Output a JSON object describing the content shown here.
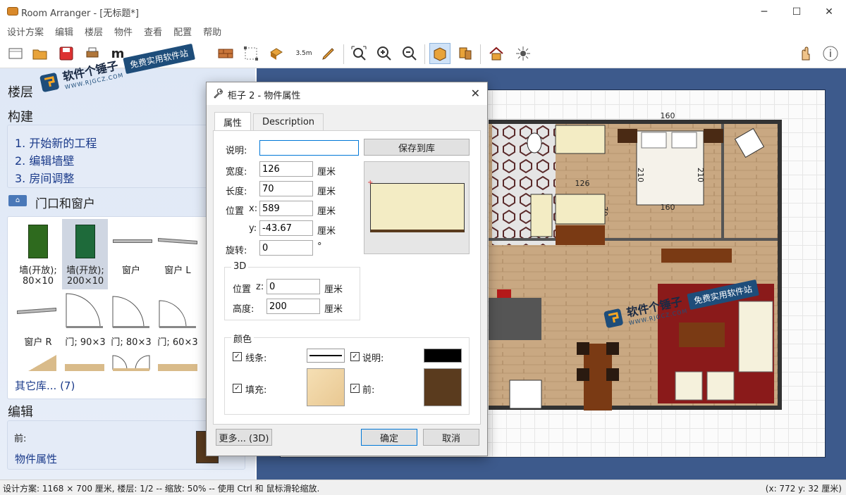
{
  "window": {
    "title": "Room Arranger - [无标题*]",
    "minimize": "─",
    "maximize": "☐",
    "close": "✕"
  },
  "menu": [
    "设计方案",
    "编辑",
    "楼层",
    "物件",
    "查看",
    "配置",
    "帮助"
  ],
  "toolbar": {
    "icons": [
      "new-icon",
      "open-icon",
      "save-icon",
      "print-icon",
      "wall-icon",
      "node-icon",
      "object-icon",
      "measure-icon",
      "pen-icon",
      "zoom-fit-icon",
      "zoom-in-icon",
      "zoom-out-icon",
      "view-2d-icon",
      "view-3d-icon",
      "house-icon",
      "effects-icon",
      "hand-icon",
      "help-icon"
    ],
    "measure_label": "3.5m",
    "partial_letter": "m"
  },
  "left_panel": {
    "floor_heading": "楼层",
    "build_heading": "构建",
    "build_steps": [
      "1. 开始新的工程",
      "2. 编辑墙壁",
      "3. 房间调整"
    ],
    "doors_heading": "门口和窗户",
    "items": [
      {
        "label": "墙(开放);\n80×10"
      },
      {
        "label": "墙(开放);\n200×10"
      },
      {
        "label": "窗户"
      },
      {
        "label": "窗户 L"
      },
      {
        "label": "窗户 R"
      },
      {
        "label": "门; 90×3"
      },
      {
        "label": "门; 80×3"
      },
      {
        "label": "门; 60×3"
      }
    ],
    "more_library": "其它库... (7)",
    "edit_heading": "编辑",
    "edit_front_label": "前:",
    "edit_properties": "物件属性"
  },
  "watermark": {
    "brand": "软件个锤子",
    "tag": "免费实用软件站",
    "url": "WWW.RJGCZ.COM"
  },
  "dialog": {
    "title": "柜子 2 - 物件属性",
    "tabs": [
      "属性",
      "Description"
    ],
    "description_label": "说明:",
    "description_value": "",
    "save_library": "保存到库",
    "width_label": "宽度:",
    "width_value": "126",
    "length_label": "长度:",
    "length_value": "70",
    "position_label": "位置",
    "x_label": "x:",
    "x_value": "589",
    "y_label": "y:",
    "y_value": "-43.67",
    "rotation_label": "旋转:",
    "rotation_value": "0",
    "degree": "°",
    "unit": "厘米",
    "group_3d": "3D",
    "pos_z_label": "位置",
    "z_label": "z:",
    "z_value": "0",
    "height_label": "高度:",
    "height_value": "200",
    "color_group": "颜色",
    "line_label": "线条:",
    "desc_color_label": "说明:",
    "fill_label": "填充:",
    "front_label": "前:",
    "colors": {
      "line": "#000000",
      "desc": "#000000",
      "fill": "#f3d9a8",
      "front": "#5a3b1e"
    },
    "more_3d": "更多... (3D)",
    "ok": "确定",
    "cancel": "取消"
  },
  "plan": {
    "dims": [
      "160",
      "210",
      "210",
      "160",
      "126",
      "70",
      "70",
      "126"
    ]
  },
  "status": {
    "left": "设计方案: 1168 × 700 厘米, 楼层: 1/2 -- 缩放: 50% -- 使用 Ctrl 和 鼠标滑轮缩放.",
    "right": "(x: 772 y: 32 厘米)"
  }
}
